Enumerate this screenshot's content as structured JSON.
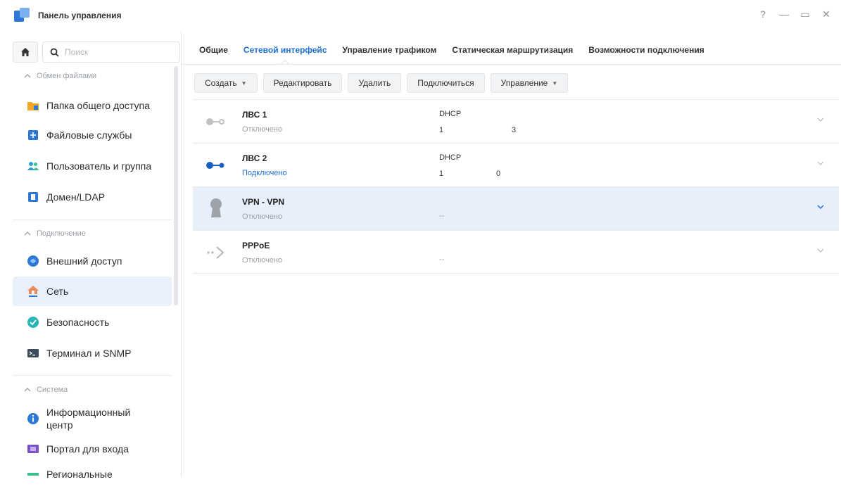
{
  "window": {
    "title": "Панель управления",
    "controls": [
      "?",
      "—",
      "▭",
      "✕"
    ]
  },
  "sidebar": {
    "search_placeholder": "Поиск",
    "sections": [
      {
        "label": "Обмен файлами",
        "items": [
          "Папка общего доступа",
          "Файловые службы",
          "Пользователь и группа",
          "Домен/LDAP"
        ]
      },
      {
        "label": "Подключение",
        "items": [
          "Внешний доступ",
          "Сеть",
          "Безопасность",
          "Терминал и SNMP"
        ]
      },
      {
        "label": "Система",
        "items": [
          "Информационный центр",
          "Портал для входа",
          "Региональные"
        ]
      }
    ],
    "active_item": "Сеть"
  },
  "tabs": [
    "Общие",
    "Сетевой интерфейс",
    "Управление трафиком",
    "Статическая маршрутизация",
    "Возможности подключения"
  ],
  "active_tab": "Сетевой интерфейс",
  "toolbar": {
    "create": "Создать",
    "edit": "Редактировать",
    "delete": "Удалить",
    "connect": "Подключиться",
    "manage": "Управление"
  },
  "interfaces": [
    {
      "name": "ЛВС 1",
      "status": "Отключено",
      "protocol": "DHCP",
      "addr_start": "1",
      "addr_end": "3"
    },
    {
      "name": "ЛВС 2",
      "status": "Подключено",
      "protocol": "DHCP",
      "addr_start": "1",
      "addr_end": "0"
    },
    {
      "name": "VPN - VPN",
      "status": "Отключено",
      "address": "--"
    },
    {
      "name": "PPPoE",
      "status": "Отключено",
      "address": "--"
    }
  ],
  "colors": {
    "accent": "#1a6fd6",
    "selected_row": "#e6effa",
    "active_nav": "#e8f0fb"
  }
}
